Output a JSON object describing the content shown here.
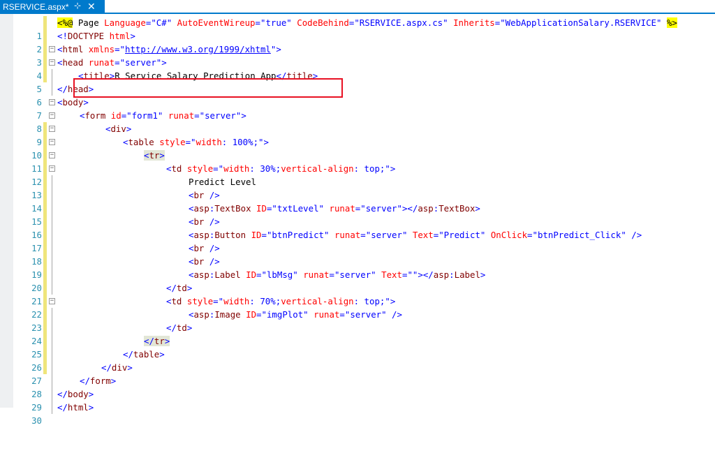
{
  "tab": {
    "title": "RSERVICE.aspx*",
    "pin_icon": "pin-icon",
    "close_icon": "close-icon",
    "pin_glyph": "⊹",
    "close_glyph": "✕"
  },
  "colors": {
    "accent": "#007acc",
    "line_number": "#2b91af",
    "tag": "#800000",
    "attribute": "#ff0000",
    "value": "#0000ff",
    "highlight_box": "#e81123"
  },
  "line_numbers": [
    "1",
    "2",
    "3",
    "4",
    "5",
    "6",
    "7",
    "8",
    "9",
    "10",
    "11",
    "12",
    "13",
    "14",
    "15",
    "16",
    "17",
    "18",
    "19",
    "20",
    "21",
    "22",
    "23",
    "24",
    "25",
    "26",
    "27",
    "28",
    "29",
    "30"
  ],
  "code": {
    "l1": [
      "<%@",
      " Page ",
      "Language",
      "=",
      "\"C#\"",
      " ",
      "AutoEventWireup",
      "=",
      "\"true\"",
      " ",
      "CodeBehind",
      "=",
      "\"RSERVICE.aspx.cs\"",
      " ",
      "Inherits",
      "=",
      "\"WebApplicationSalary.RSERVICE\"",
      " ",
      "%>"
    ],
    "l2": [
      "<!",
      "DOCTYPE",
      " ",
      "html",
      ">"
    ],
    "l3": [
      "<",
      "html",
      " ",
      "xmlns",
      "=\"",
      "http://www.w3.org/1999/xhtml",
      "\">"
    ],
    "l4": [
      "<",
      "head",
      " ",
      "runat",
      "=",
      "\"server\"",
      ">"
    ],
    "l5": [
      "<",
      "title",
      ">",
      "R Service Salary Prediction App",
      "</",
      "title",
      ">"
    ],
    "l6": [
      "</",
      "head",
      ">"
    ],
    "l7": [
      "<",
      "body",
      ">"
    ],
    "l8": [
      "<",
      "form",
      " ",
      "id",
      "=",
      "\"form1\"",
      " ",
      "runat",
      "=",
      "\"server\"",
      ">"
    ],
    "l9": [
      "<",
      "div",
      ">"
    ],
    "l10": [
      "<",
      "table",
      " ",
      "style",
      "=\"",
      "width",
      ":",
      " 100%;",
      "\">"
    ],
    "l11": [
      "<",
      "tr",
      ">"
    ],
    "l12": [
      "<",
      "td",
      " ",
      "style",
      "=\"",
      "width",
      ":",
      " 30%;",
      "vertical-align",
      ":",
      " top;",
      "\">"
    ],
    "l13": [
      "Predict Level"
    ],
    "l14": [
      "<",
      "br",
      " />"
    ],
    "l15": [
      "<",
      "asp",
      ":",
      "TextBox",
      " ",
      "ID",
      "=",
      "\"txtLevel\"",
      " ",
      "runat",
      "=",
      "\"server\"",
      "></",
      "asp",
      ":",
      "TextBox",
      ">"
    ],
    "l16": [
      "<",
      "br",
      " />"
    ],
    "l17": [
      "<",
      "asp",
      ":",
      "Button",
      " ",
      "ID",
      "=",
      "\"btnPredict\"",
      " ",
      "runat",
      "=",
      "\"server\"",
      " ",
      "Text",
      "=",
      "\"Predict\"",
      " ",
      "OnClick",
      "=",
      "\"btnPredict_Click\"",
      " />"
    ],
    "l18": [
      "<",
      "br",
      " />"
    ],
    "l19": [
      "<",
      "br",
      " />"
    ],
    "l20": [
      "<",
      "asp",
      ":",
      "Label",
      " ",
      "ID",
      "=",
      "\"lbMsg\"",
      " ",
      "runat",
      "=",
      "\"server\"",
      " ",
      "Text",
      "=",
      "\"\"",
      "></",
      "asp",
      ":",
      "Label",
      ">"
    ],
    "l21": [
      "</",
      "td",
      ">"
    ],
    "l22": [
      "<",
      "td",
      " ",
      "style",
      "=\"",
      "width",
      ":",
      " 70%;",
      "vertical-align",
      ":",
      " top;",
      "\">"
    ],
    "l23": [
      "<",
      "asp",
      ":",
      "Image",
      " ",
      "ID",
      "=",
      "\"imgPlot\"",
      " ",
      "runat",
      "=",
      "\"server\"",
      " />"
    ],
    "l24": [
      "</",
      "td",
      ">"
    ],
    "l25": [
      "</",
      "tr",
      ">"
    ],
    "l26": [
      "</",
      "table",
      ">"
    ],
    "l27": [
      "</",
      "div",
      ">"
    ],
    "l28": [
      "</",
      "form",
      ">"
    ],
    "l29": [
      "</",
      "body",
      ">"
    ],
    "l30": [
      "</",
      "html",
      ">"
    ]
  },
  "fold_glyph": "−"
}
